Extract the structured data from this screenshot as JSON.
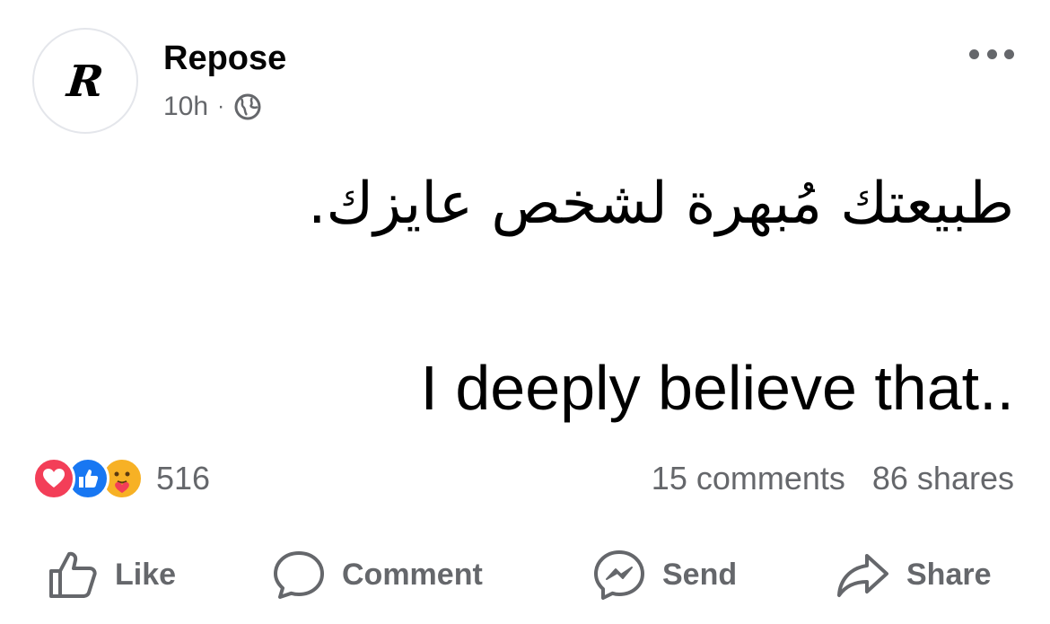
{
  "post": {
    "page_name": "Repose",
    "avatar_letter": "R",
    "time": "10h",
    "separator": "·",
    "privacy_icon": "globe-icon",
    "more_icon": "more-horizontal-icon",
    "text_arabic": "طبيعتك مُبهرة لشخص عايزك.",
    "text_english": "I deeply believe that.."
  },
  "engagement": {
    "reactions": [
      "love-reaction-icon",
      "like-reaction-icon",
      "care-reaction-icon"
    ],
    "reaction_count": "516",
    "comments": "15 comments",
    "shares": "86 shares"
  },
  "actions": {
    "like": "Like",
    "comment": "Comment",
    "send": "Send",
    "share": "Share"
  },
  "colors": {
    "secondary_text": "#65676b",
    "like_blue": "#1877f2",
    "love_red": "#f33e58",
    "care_yellow": "#f7b125"
  }
}
